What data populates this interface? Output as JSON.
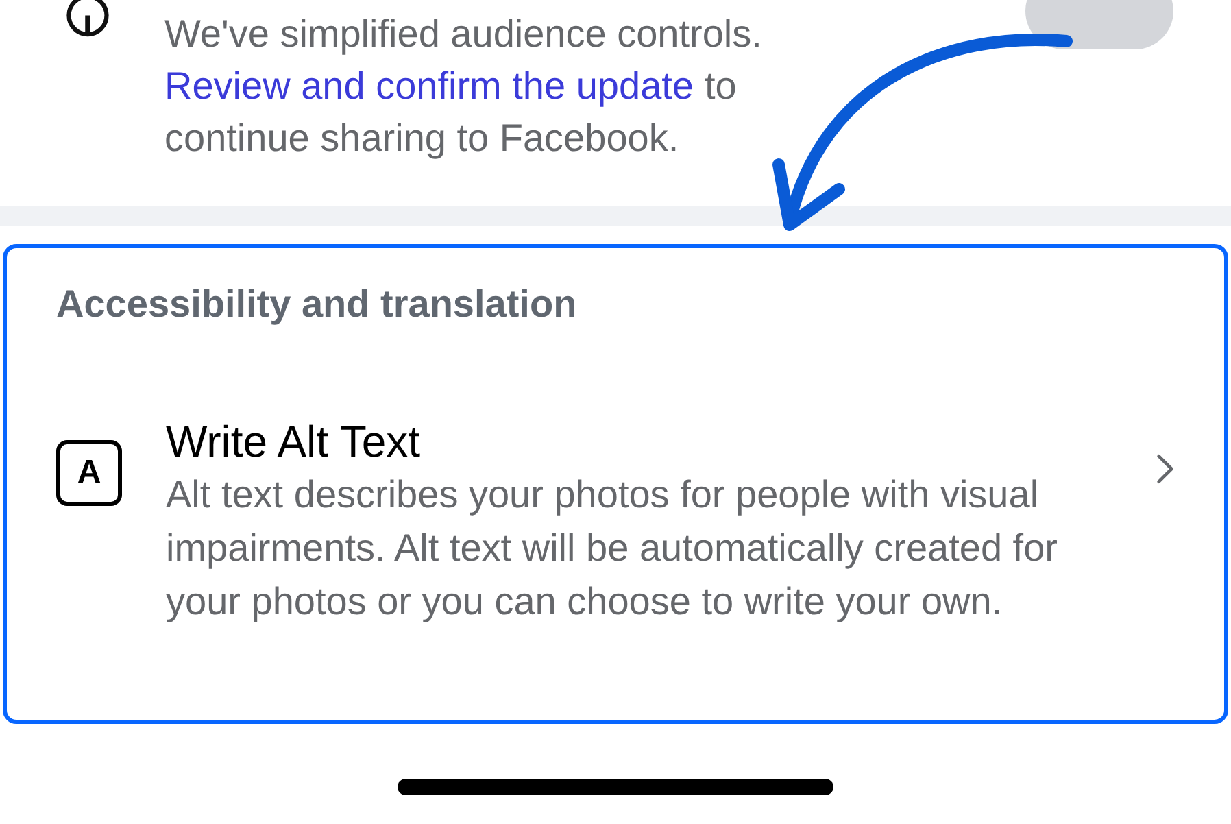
{
  "sharing_notice": {
    "text": "We've simplified audience controls.",
    "link": "Review and confirm the update",
    "text_after": "to",
    "text_last_line": "continue sharing to Facebook.",
    "toggle_on": false
  },
  "section": {
    "title": "Accessibility and translation",
    "items": [
      {
        "title": "Write Alt Text",
        "icon_letter": "A",
        "description": "Alt text describes your photos for people with visual impairments. Alt text will be automatically created for your photos or you can choose to write your own."
      }
    ]
  }
}
